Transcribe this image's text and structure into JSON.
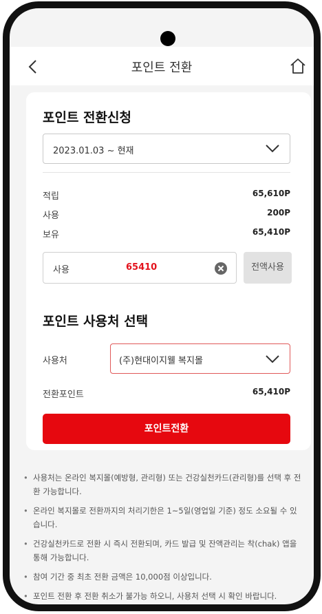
{
  "header": {
    "title": "포인트 전환"
  },
  "apply": {
    "heading": "포인트 전환신청",
    "period": "2023.01.03 ~ 현재",
    "rows": [
      {
        "label": "적립",
        "value": "65,610P"
      },
      {
        "label": "사용",
        "value": "200P"
      },
      {
        "label": "보유",
        "value": "65,410P"
      }
    ],
    "use_label": "사용",
    "use_amount": "65410",
    "all_use_button": "전액사용"
  },
  "destination": {
    "heading": "포인트 사용처 선택",
    "label": "사용처",
    "selected": "(주)현대이지웰 복지몰",
    "convert_label": "전환포인트",
    "convert_value": "65,410P",
    "submit": "포인트전환"
  },
  "notes": [
    "사용처는 온라인 복지몰(예방형, 관리형) 또는 건강실천카드(관리형)를 선택 후 전환 가능합니다.",
    "온라인 복지몰로 전환까지의 처리기한은 1~5일(영업일 기준) 정도 소요될 수 있습니다.",
    "건강실천카드로 전환 시 즉시 전환되며, 카드 발급 및 잔액관리는 착(chak) 앱을 통해 가능합니다.",
    "참여 기간 중 최초 전환 금액은 10,000점 이상입니다.",
    "포인트 전환 후 전환 취소가 불가능 하오니, 사용처 선택 시 확인 바랍니다."
  ],
  "colors": {
    "accent": "#e6080f",
    "amount": "#e3121c",
    "background": "#f4f4f4"
  },
  "icons": [
    "back-icon",
    "home-icon",
    "chevron-down-icon",
    "clear-icon"
  ]
}
